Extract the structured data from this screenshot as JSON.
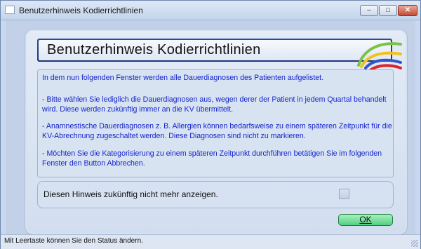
{
  "window": {
    "title": "Benutzerhinweis Kodierrichtlinien",
    "buttons": {
      "minimize": "–",
      "maximize": "□",
      "close": "✕"
    }
  },
  "dialog": {
    "heading": "Benutzerhinweis Kodierrichtlinien",
    "info_lines": [
      "In dem nun folgenden Fenster werden alle Dauerdiagnosen des Patienten aufgelistet.",
      "- Bitte wählen Sie lediglich die Dauerdiagnosen aus, wegen derer der Patient in jedem Quartal behandelt",
      "  wird. Diese werden zukünftig immer an die KV übermittelt.",
      "- Anamnestische Dauerdiagnosen z. B. Allergien können bedarfsweise zu einem späteren Zeitpunkt für die",
      "  KV-Abrechnung zugeschaltet werden. Diese Diagnosen sind nicht zu markieren.",
      "- Möchten Sie die Kategorisierung zu einem späteren Zeitpunkt durchführen betätigen Sie im folgenden",
      "  Fenster den Button Abbrechen."
    ],
    "hint_label": "Diesen Hinweis zukünftig nicht mehr anzeigen.",
    "hint_checked": false,
    "ok_label": "OK"
  },
  "status": {
    "text": "Mit Leertaste können Sie den Status ändern."
  },
  "colors": {
    "info_text": "#1424cc",
    "header_border": "#2c4a9c",
    "ok_button": "#54cf83"
  },
  "icons": {
    "logo": "swoosh-logo",
    "app": "window-icon"
  }
}
